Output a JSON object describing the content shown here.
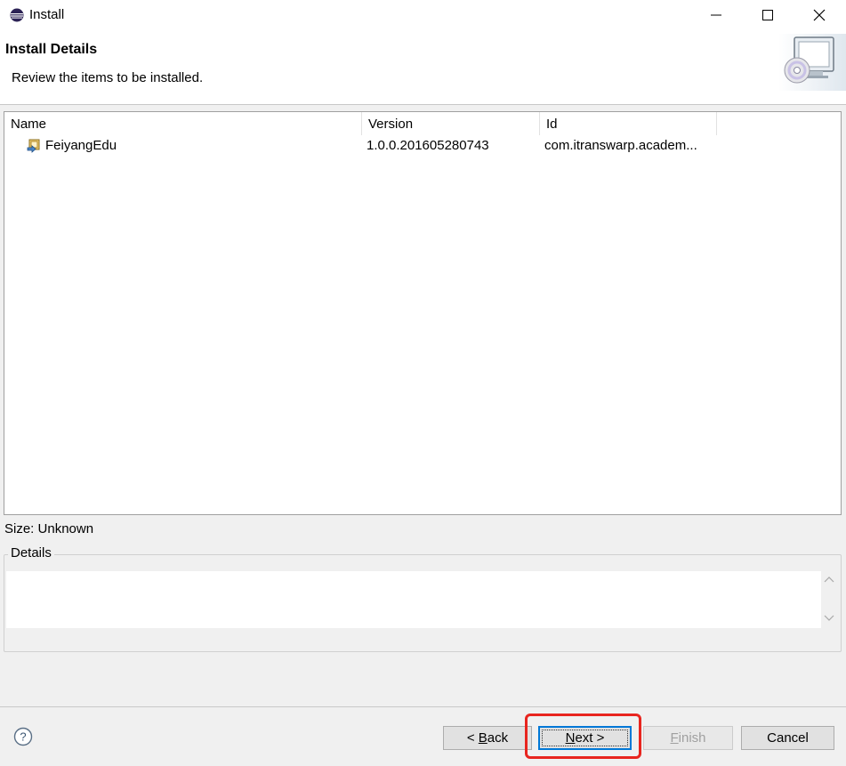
{
  "window": {
    "title": "Install"
  },
  "header": {
    "title": "Install Details",
    "description": "Review the items to be installed."
  },
  "table": {
    "columns": [
      "Name",
      "Version",
      "Id"
    ],
    "rows": [
      {
        "name": "FeiyangEdu",
        "version": "1.0.0.201605280743",
        "id": "com.itranswarp.academ...",
        "icon": "feature-icon"
      }
    ]
  },
  "size": {
    "label": "Size: Unknown"
  },
  "details": {
    "legend": "Details",
    "text": ""
  },
  "buttons": {
    "back": {
      "prefix": "< ",
      "mnemonic": "B",
      "rest": "ack"
    },
    "next": {
      "mnemonic": "N",
      "rest": "ext >"
    },
    "finish": {
      "mnemonic": "F",
      "rest": "inish"
    },
    "cancel": "Cancel"
  },
  "colors": {
    "highlight": "#e8251f",
    "focus": "#0078d7"
  }
}
